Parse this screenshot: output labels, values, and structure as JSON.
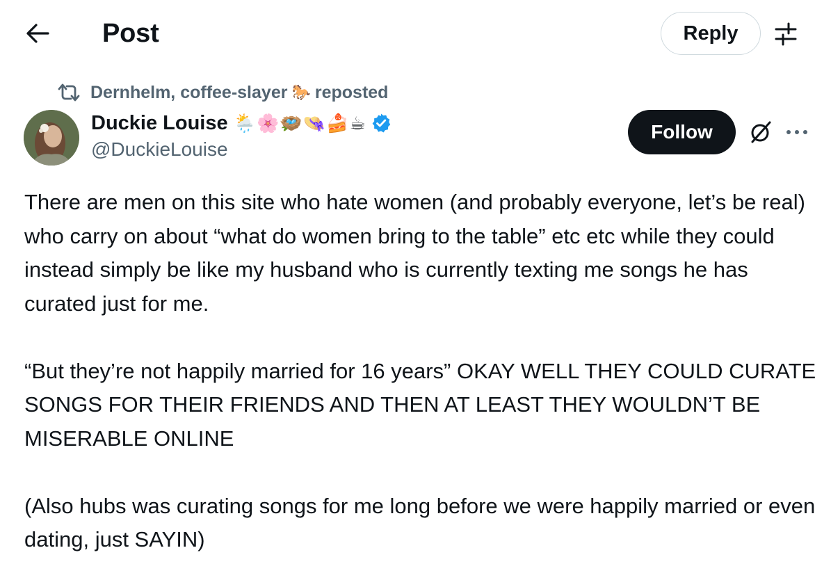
{
  "header": {
    "title": "Post",
    "back_icon": "back-arrow-icon",
    "reply_label": "Reply",
    "settings_icon": "sliders-icon"
  },
  "repost": {
    "icon": "repost-icon",
    "name": "Dernhelm, coffee-slayer",
    "emoji": "🐎",
    "suffix": "reposted"
  },
  "author": {
    "name": "Duckie Louise",
    "emojis": "🌦️🌸🪺👒🍰☕",
    "handle": "@DuckieLouise",
    "verified": true,
    "avatar": "avatar-photo"
  },
  "actions": {
    "follow_label": "Follow",
    "grok_icon": "grok-icon",
    "more_icon": "more-icon"
  },
  "post": {
    "paragraphs": [
      "There are men on this site who hate women (and probably everyone, let’s be real) who carry on about “what do women bring to the table” etc etc while they could instead simply be like my husband who is currently texting me songs he has curated just for me.",
      "“But they’re not happily married for 16 years” OKAY WELL THEY COULD CURATE SONGS FOR THEIR FRIENDS AND THEN AT LEAST THEY WOULDN’T BE MISERABLE ONLINE",
      "(Also hubs was curating songs for me long before we were happily married or even dating, just SAYIN)"
    ]
  },
  "colors": {
    "text": "#0f1419",
    "secondary": "#536471",
    "border": "#cfd9de",
    "verified": "#1d9bf0",
    "follow_bg": "#0f1419"
  }
}
